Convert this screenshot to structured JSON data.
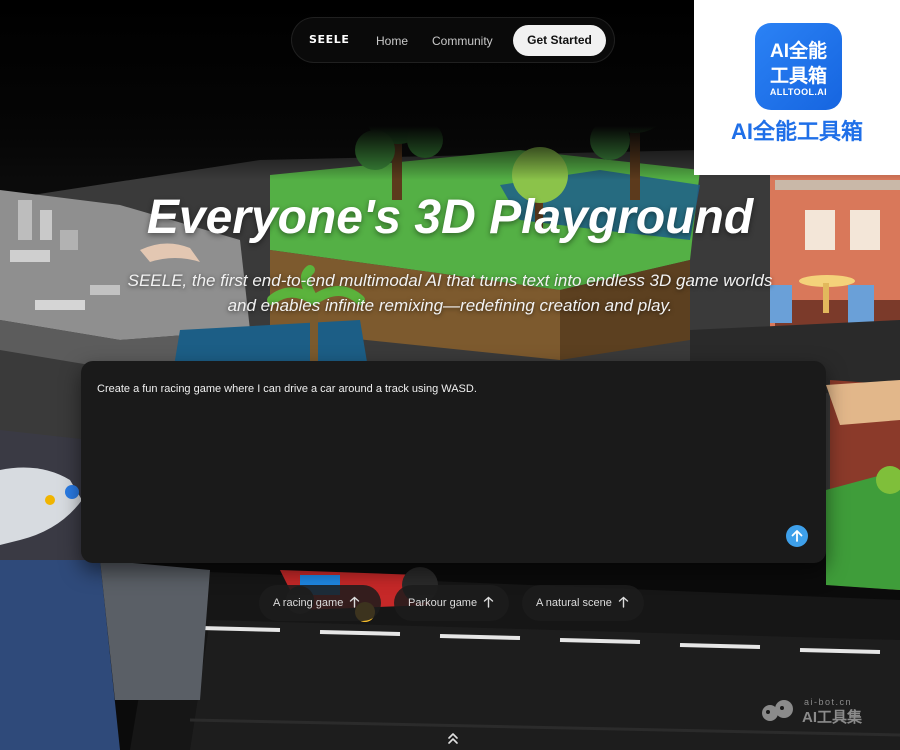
{
  "nav": {
    "logo": "SEELE",
    "home": "Home",
    "community": "Community",
    "cta": "Get Started"
  },
  "watermark": {
    "tile_line1": "AI全能",
    "tile_line2": "工具箱",
    "tile_line3": "ALLTOOL.AI",
    "caption": "AI全能工具箱"
  },
  "hero": {
    "title": "Everyone's 3D Playground",
    "subtitle_line1": "SEELE, the first end-to-end multimodal AI that turns text into endless 3D game worlds",
    "subtitle_line2": "and enables infinite remixing—redefining creation and play."
  },
  "prompt": {
    "value": "Create a fun racing game where I can drive a car around a track using WASD.",
    "send_icon": "arrow-up-icon"
  },
  "suggestions": [
    {
      "label": "A racing game",
      "icon": "arrow-up-icon"
    },
    {
      "label": "Parkour game",
      "icon": "arrow-up-icon"
    },
    {
      "label": "A natural scene",
      "icon": "arrow-up-icon"
    }
  ],
  "bottom_watermark": {
    "small": "ai-bot.cn",
    "big": "AI工具集"
  },
  "colors": {
    "accent": "#3ea0ea",
    "panel": "#1a1a1a",
    "cta_bg": "#f1f1f1",
    "watermark_blue": "#1f6fe8"
  }
}
